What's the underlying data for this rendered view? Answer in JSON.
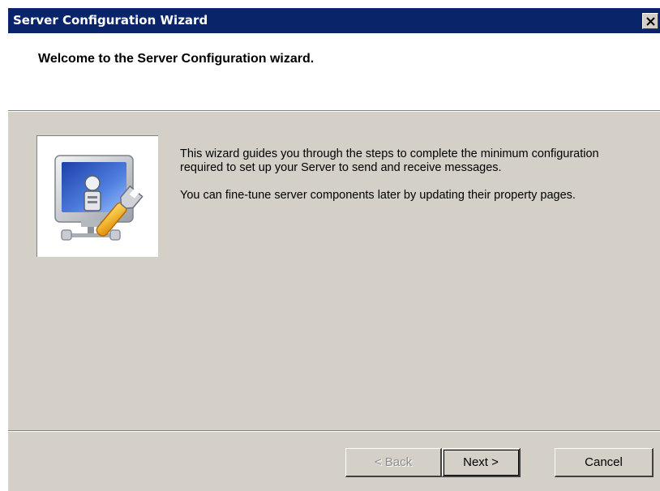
{
  "window": {
    "title": "Server Configuration Wizard",
    "close_glyph": "✕"
  },
  "header": {
    "title": "Welcome to the Server Configuration wizard."
  },
  "body": {
    "paragraph1": "This wizard guides you through the steps to complete the minimum configuration required to set up your Server to send and receive messages.",
    "paragraph2": "You can fine-tune server components later by updating their property pages."
  },
  "image": {
    "icon": "server-wrench-icon"
  },
  "buttons": {
    "back": "< Back",
    "next": "Next >",
    "cancel": "Cancel"
  },
  "colors": {
    "titlebar": "#0a246a",
    "dialog_background": "#d4d0c8",
    "header_background": "#ffffff"
  }
}
